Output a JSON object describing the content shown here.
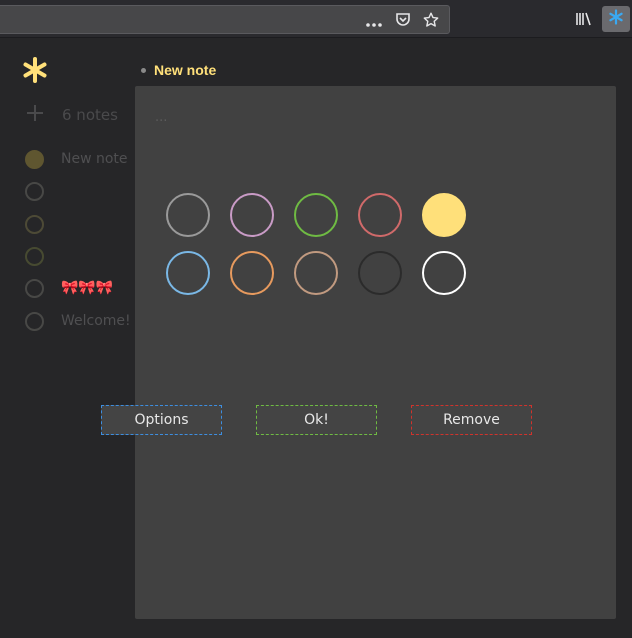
{
  "toolbar": {
    "more_icon": "ellipsis-icon",
    "pocket_icon": "pocket-icon",
    "bookmark_icon": "star-icon",
    "library_icon": "library-icon",
    "extension_icon": "asterisk-icon",
    "more_label": "•••"
  },
  "sidebar": {
    "add_label": "6 notes",
    "notes": [
      {
        "label": "New note",
        "color": "#ffe07a"
      },
      {
        "label": "",
        "color": "#9a9a9a"
      },
      {
        "label": "",
        "color": "#9a9a9a"
      },
      {
        "label": "",
        "color": "#9a9a9a"
      },
      {
        "label": "🎀🎀🎀",
        "color": "#9a9a9a"
      },
      {
        "label": "Welcome!",
        "color": "#9a9a9a"
      }
    ]
  },
  "note": {
    "title": "New note",
    "body_placeholder": "..."
  },
  "colors": [
    {
      "name": "gray",
      "hex": "#9a9a9a",
      "selected": false
    },
    {
      "name": "purple",
      "hex": "#c99bc6",
      "selected": false
    },
    {
      "name": "green",
      "hex": "#6fbb43",
      "selected": false
    },
    {
      "name": "red",
      "hex": "#d06a6a",
      "selected": false
    },
    {
      "name": "yellow",
      "hex": "#ffe07a",
      "selected": true
    },
    {
      "name": "blue",
      "hex": "#7ab8e6",
      "selected": false
    },
    {
      "name": "orange",
      "hex": "#e79a5e",
      "selected": false
    },
    {
      "name": "brown",
      "hex": "#c19a80",
      "selected": false
    },
    {
      "name": "black",
      "hex": "#2b2b2b",
      "selected": false
    },
    {
      "name": "white",
      "hex": "#ffffff",
      "selected": false
    }
  ],
  "buttons": {
    "options": {
      "label": "Options",
      "border": "#3d8ee0"
    },
    "ok": {
      "label": "Ok!",
      "border": "#6fbb43"
    },
    "remove": {
      "label": "Remove",
      "border": "#d0332c"
    }
  }
}
